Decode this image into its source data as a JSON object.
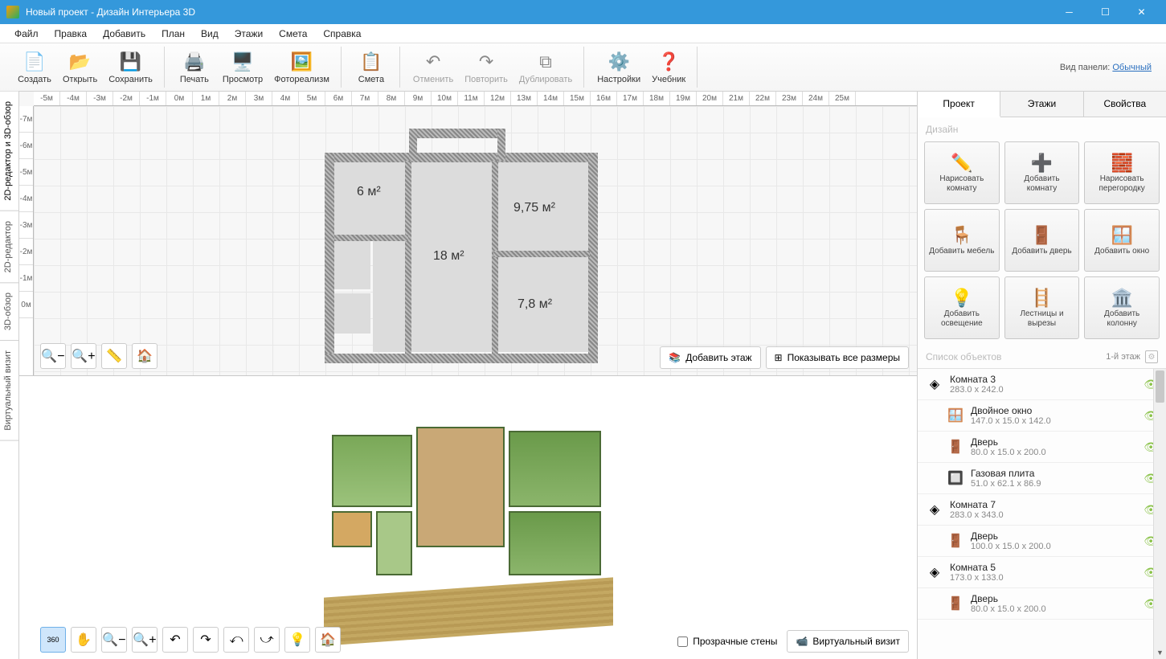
{
  "window": {
    "title": "Новый проект - Дизайн Интерьера 3D"
  },
  "menu": {
    "file": "Файл",
    "edit": "Правка",
    "add": "Добавить",
    "plan": "План",
    "view": "Вид",
    "floors": "Этажи",
    "estimate": "Смета",
    "help": "Справка"
  },
  "toolbar": {
    "create": "Создать",
    "open": "Открыть",
    "save": "Сохранить",
    "print": "Печать",
    "preview": "Просмотр",
    "photorealism": "Фотореализм",
    "estimate": "Смета",
    "undo": "Отменить",
    "redo": "Повторить",
    "duplicate": "Дублировать",
    "settings": "Настройки",
    "tutorial": "Учебник",
    "panel_mode_label": "Вид панели:",
    "panel_mode_value": "Обычный"
  },
  "left_tabs": {
    "combined": "2D-редактор и 3D-обзор",
    "editor": "2D-редактор",
    "overview": "3D-обзор",
    "virtual": "Виртуальный визит"
  },
  "ruler_h": [
    "-5м",
    "-4м",
    "-3м",
    "-2м",
    "-1м",
    "0м",
    "1м",
    "2м",
    "3м",
    "4м",
    "5м",
    "6м",
    "7м",
    "8м",
    "9м",
    "10м",
    "11м",
    "12м",
    "13м",
    "14м",
    "15м",
    "16м",
    "17м",
    "18м",
    "19м",
    "20м",
    "21м",
    "22м",
    "23м",
    "24м",
    "25м"
  ],
  "ruler_v": [
    "-7м",
    "-6м",
    "-5м",
    "-4м",
    "-3м",
    "-2м",
    "-1м",
    "0м"
  ],
  "rooms": {
    "r1": "6 м²",
    "r2": "18 м²",
    "r3": "9,75 м²",
    "r4": "7,8 м²"
  },
  "pane2d": {
    "add_floor": "Добавить этаж",
    "show_dims": "Показывать все размеры"
  },
  "pane3d": {
    "transparent_walls": "Прозрачные стены",
    "virtual_visit": "Виртуальный визит"
  },
  "right_tabs": {
    "project": "Проект",
    "floors": "Этажи",
    "properties": "Свойства"
  },
  "rp_section1": "Дизайн",
  "rp_buttons": [
    {
      "label": "Нарисовать комнату",
      "icon": "✏️"
    },
    {
      "label": "Добавить комнату",
      "icon": "➕"
    },
    {
      "label": "Нарисовать перегородку",
      "icon": "🧱"
    },
    {
      "label": "Добавить мебель",
      "icon": "🪑"
    },
    {
      "label": "Добавить дверь",
      "icon": "🚪"
    },
    {
      "label": "Добавить окно",
      "icon": "🪟"
    },
    {
      "label": "Добавить освещение",
      "icon": "💡"
    },
    {
      "label": "Лестницы и вырезы",
      "icon": "🪜"
    },
    {
      "label": "Добавить колонну",
      "icon": "🏛️"
    }
  ],
  "obj_section": "Список объектов",
  "obj_meta": "1-й этаж",
  "objects": [
    {
      "name": "Комната 3",
      "dims": "283.0 x 242.0",
      "icon": "◈",
      "child": false
    },
    {
      "name": "Двойное окно",
      "dims": "147.0 x 15.0 x 142.0",
      "icon": "🪟",
      "child": true
    },
    {
      "name": "Дверь",
      "dims": "80.0 x 15.0 x 200.0",
      "icon": "🚪",
      "child": true
    },
    {
      "name": "Газовая плита",
      "dims": "51.0 x 62.1 x 86.9",
      "icon": "🔲",
      "child": true
    },
    {
      "name": "Комната 7",
      "dims": "283.0 x 343.0",
      "icon": "◈",
      "child": false
    },
    {
      "name": "Дверь",
      "dims": "100.0 x 15.0 x 200.0",
      "icon": "🚪",
      "child": true
    },
    {
      "name": "Комната 5",
      "dims": "173.0 x 133.0",
      "icon": "◈",
      "child": false
    },
    {
      "name": "Дверь",
      "dims": "80.0 x 15.0 x 200.0",
      "icon": "🚪",
      "child": true
    }
  ]
}
